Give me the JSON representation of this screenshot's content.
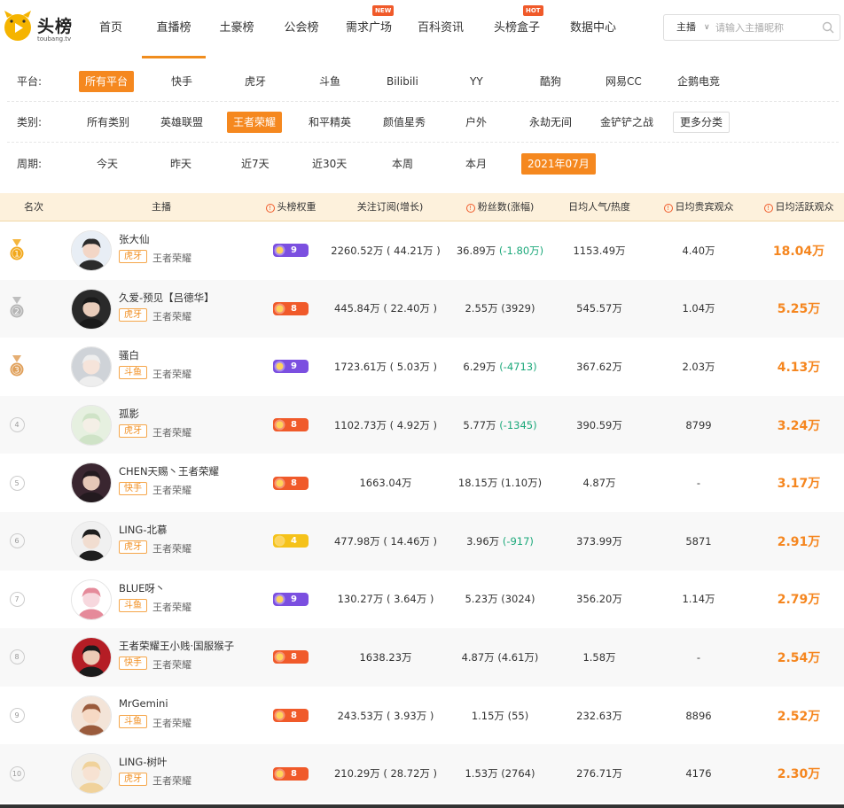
{
  "brand": {
    "logo_text": "头榜",
    "logo_sub": "toubang.tv"
  },
  "nav": [
    {
      "label": "首页",
      "badge": ""
    },
    {
      "label": "直播榜",
      "badge": "",
      "active": true
    },
    {
      "label": "土豪榜",
      "badge": ""
    },
    {
      "label": "公会榜",
      "badge": ""
    },
    {
      "label": "需求广场",
      "badge": "NEW"
    },
    {
      "label": "百科资讯",
      "badge": ""
    },
    {
      "label": "头榜盒子",
      "badge": "HOT"
    },
    {
      "label": "数据中心",
      "badge": ""
    }
  ],
  "search": {
    "type": "主播",
    "placeholder": "请输入主播昵称"
  },
  "filters": {
    "platform": {
      "label": "平台:",
      "selected": 0,
      "options": [
        "所有平台",
        "快手",
        "虎牙",
        "斗鱼",
        "Bilibili",
        "YY",
        "酷狗",
        "网易CC",
        "企鹅电竞"
      ]
    },
    "category": {
      "label": "类别:",
      "selected": 2,
      "options": [
        "所有类别",
        "英雄联盟",
        "王者荣耀",
        "和平精英",
        "颜值星秀",
        "户外",
        "永劫无间",
        "金铲铲之战"
      ],
      "more": "更多分类"
    },
    "period": {
      "label": "周期:",
      "selected": 6,
      "options": [
        "今天",
        "昨天",
        "近7天",
        "近30天",
        "本周",
        "本月",
        "2021年07月"
      ]
    }
  },
  "table": {
    "headers": {
      "rank": "名次",
      "streamer": "主播",
      "weight": "头榜权重",
      "follow": "关注订阅(增长)",
      "fans": "粉丝数(涨幅)",
      "popularity": "日均人气/热度",
      "viewers": "日均贵宾观众",
      "active": "日均活跃观众"
    },
    "rows": [
      {
        "rank": "1",
        "name": "张大仙",
        "platform": "虎牙",
        "category": "王者荣耀",
        "weight_level": "9",
        "weight_color": "#7b4fe0",
        "follow": "2260.52万 ( 44.21万 )",
        "fans_value": "36.89万",
        "fans_change": "(-1.80万)",
        "fans_neg": true,
        "popularity": "1153.49万",
        "viewers": "4.40万",
        "active": "18.04万"
      },
      {
        "rank": "2",
        "name": "久爱-预见【吕德华】",
        "platform": "虎牙",
        "category": "王者荣耀",
        "weight_level": "8",
        "weight_color": "#f05a2a",
        "follow": "445.84万 ( 22.40万 )",
        "fans_value": "2.55万",
        "fans_change": "(3929)",
        "fans_neg": false,
        "popularity": "545.57万",
        "viewers": "1.04万",
        "active": "5.25万"
      },
      {
        "rank": "3",
        "name": "骚白",
        "platform": "斗鱼",
        "category": "王者荣耀",
        "weight_level": "9",
        "weight_color": "#7b4fe0",
        "follow": "1723.61万 ( 5.03万 )",
        "fans_value": "6.29万",
        "fans_change": "(-4713)",
        "fans_neg": true,
        "popularity": "367.62万",
        "viewers": "2.03万",
        "active": "4.13万"
      },
      {
        "rank": "4",
        "name": "孤影",
        "platform": "虎牙",
        "category": "王者荣耀",
        "weight_level": "8",
        "weight_color": "#f05a2a",
        "follow": "1102.73万 ( 4.92万 )",
        "fans_value": "5.77万",
        "fans_change": "(-1345)",
        "fans_neg": true,
        "popularity": "390.59万",
        "viewers": "8799",
        "active": "3.24万"
      },
      {
        "rank": "5",
        "name": "CHEN天赐丶王者荣耀",
        "platform": "快手",
        "category": "王者荣耀",
        "weight_level": "8",
        "weight_color": "#f05a2a",
        "follow": "1663.04万",
        "fans_value": "18.15万",
        "fans_change": "(1.10万)",
        "fans_neg": false,
        "popularity": "4.87万",
        "viewers": "-",
        "active": "3.17万"
      },
      {
        "rank": "6",
        "name": "LING-北慕",
        "platform": "虎牙",
        "category": "王者荣耀",
        "weight_level": "4",
        "weight_color": "#f5c21a",
        "follow": "477.98万 ( 14.46万 )",
        "fans_value": "3.96万",
        "fans_change": "(-917)",
        "fans_neg": true,
        "popularity": "373.99万",
        "viewers": "5871",
        "active": "2.91万"
      },
      {
        "rank": "7",
        "name": "BLUE呀丶",
        "platform": "斗鱼",
        "category": "王者荣耀",
        "weight_level": "9",
        "weight_color": "#7b4fe0",
        "follow": "130.27万 ( 3.64万 )",
        "fans_value": "5.23万",
        "fans_change": "(3024)",
        "fans_neg": false,
        "popularity": "356.20万",
        "viewers": "1.14万",
        "active": "2.79万"
      },
      {
        "rank": "8",
        "name": "王者荣耀王小贱·国服猴子",
        "platform": "快手",
        "category": "王者荣耀",
        "weight_level": "8",
        "weight_color": "#f05a2a",
        "follow": "1638.23万",
        "fans_value": "4.87万",
        "fans_change": "(4.61万)",
        "fans_neg": false,
        "popularity": "1.58万",
        "viewers": "-",
        "active": "2.54万"
      },
      {
        "rank": "9",
        "name": "MrGemini",
        "platform": "斗鱼",
        "category": "王者荣耀",
        "weight_level": "8",
        "weight_color": "#f05a2a",
        "follow": "243.53万 ( 3.93万 )",
        "fans_value": "1.15万",
        "fans_change": "(55)",
        "fans_neg": false,
        "popularity": "232.63万",
        "viewers": "8896",
        "active": "2.52万"
      },
      {
        "rank": "10",
        "name": "LING-树叶",
        "platform": "虎牙",
        "category": "王者荣耀",
        "weight_level": "8",
        "weight_color": "#f05a2a",
        "follow": "210.29万 ( 28.72万 )",
        "fans_value": "1.53万",
        "fans_change": "(2764)",
        "fans_neg": false,
        "popularity": "276.71万",
        "viewers": "4176",
        "active": "2.30万"
      }
    ]
  },
  "colors": {
    "accent": "#f5881f",
    "header_bg": "#fdf1dc",
    "negative": "#1ba87a",
    "gold": "#f2a81c",
    "silver": "#b5b5b5",
    "bronze": "#e0a05a"
  }
}
